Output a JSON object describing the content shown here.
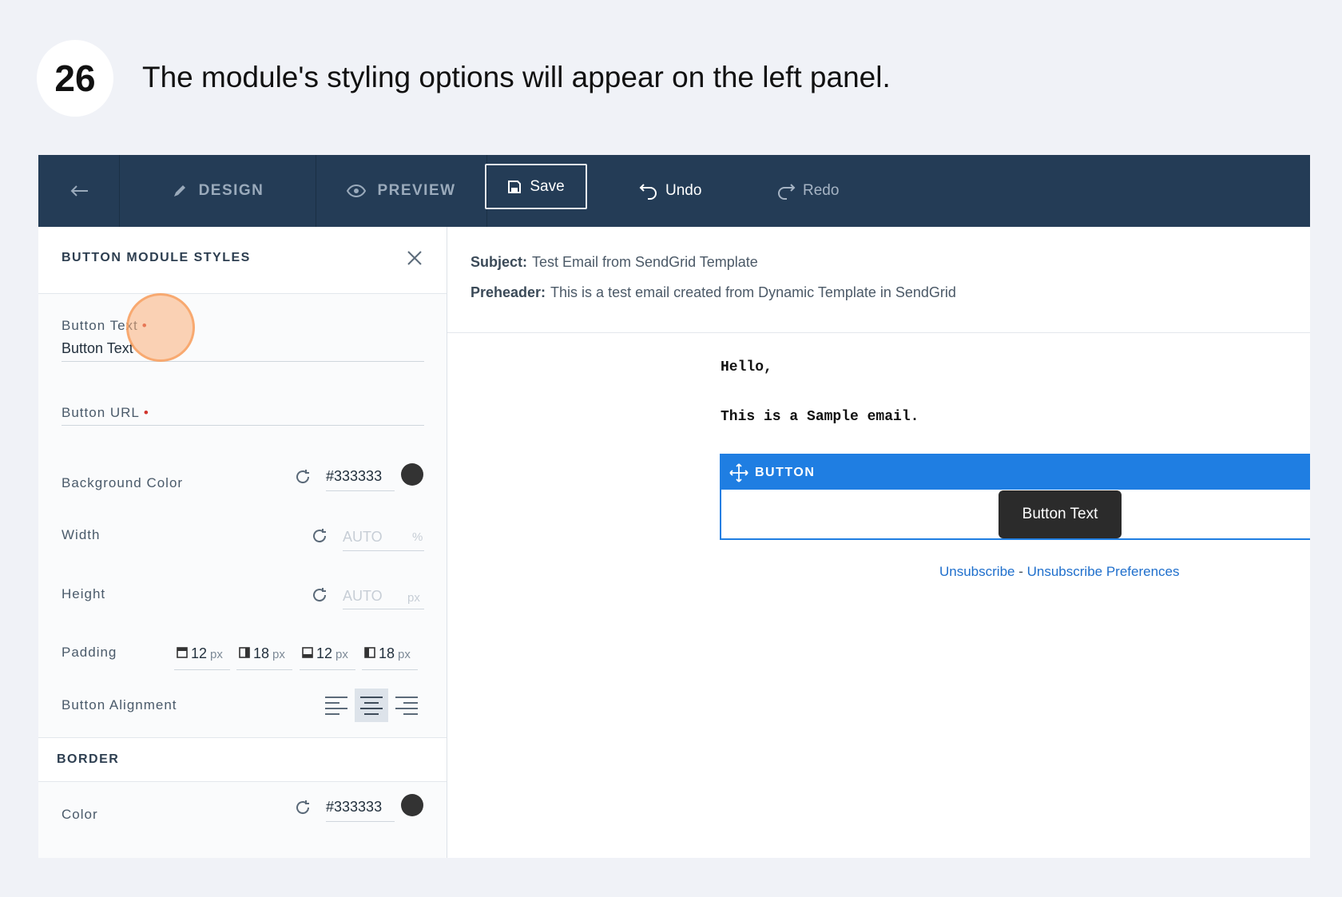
{
  "step": {
    "number": "26",
    "instruction": "The module's styling options will appear on the left panel."
  },
  "toolbar": {
    "design_label": "DESIGN",
    "preview_label": "PREVIEW",
    "save_label": "Save",
    "undo_label": "Undo",
    "redo_label": "Redo"
  },
  "panel": {
    "title": "BUTTON MODULE STYLES",
    "button_text_label": "Button Text",
    "button_text_value": "Button Text",
    "button_url_label": "Button URL",
    "required_marker": "•",
    "bg_color_label": "Background Color",
    "bg_color_value": "#333333",
    "width_label": "Width",
    "width_value": "AUTO",
    "width_unit": "%",
    "height_label": "Height",
    "height_value": "AUTO",
    "height_unit": "px",
    "padding_label": "Padding",
    "padding": [
      {
        "value": "12",
        "unit": "px"
      },
      {
        "value": "18",
        "unit": "px"
      },
      {
        "value": "12",
        "unit": "px"
      },
      {
        "value": "18",
        "unit": "px"
      }
    ],
    "alignment_label": "Button Alignment",
    "alignment_selected": "center",
    "border_section": "BORDER",
    "border_color_label": "Color",
    "border_color_value": "#333333"
  },
  "email": {
    "subject_label": "Subject:",
    "subject_value": "Test Email from SendGrid Template",
    "preheader_label": "Preheader:",
    "preheader_value": "This is a test email created from Dynamic Template in SendGrid",
    "greeting": "Hello,",
    "body": "This is a Sample email.",
    "module_label": "BUTTON",
    "button_text": "Button Text",
    "unsubscribe": "Unsubscribe",
    "separator": " - ",
    "unsubscribe_prefs": "Unsubscribe Preferences"
  },
  "colors": {
    "toolbar_bg": "#243c56",
    "accent_blue": "#1f7ee2",
    "swatch": "#333333"
  }
}
